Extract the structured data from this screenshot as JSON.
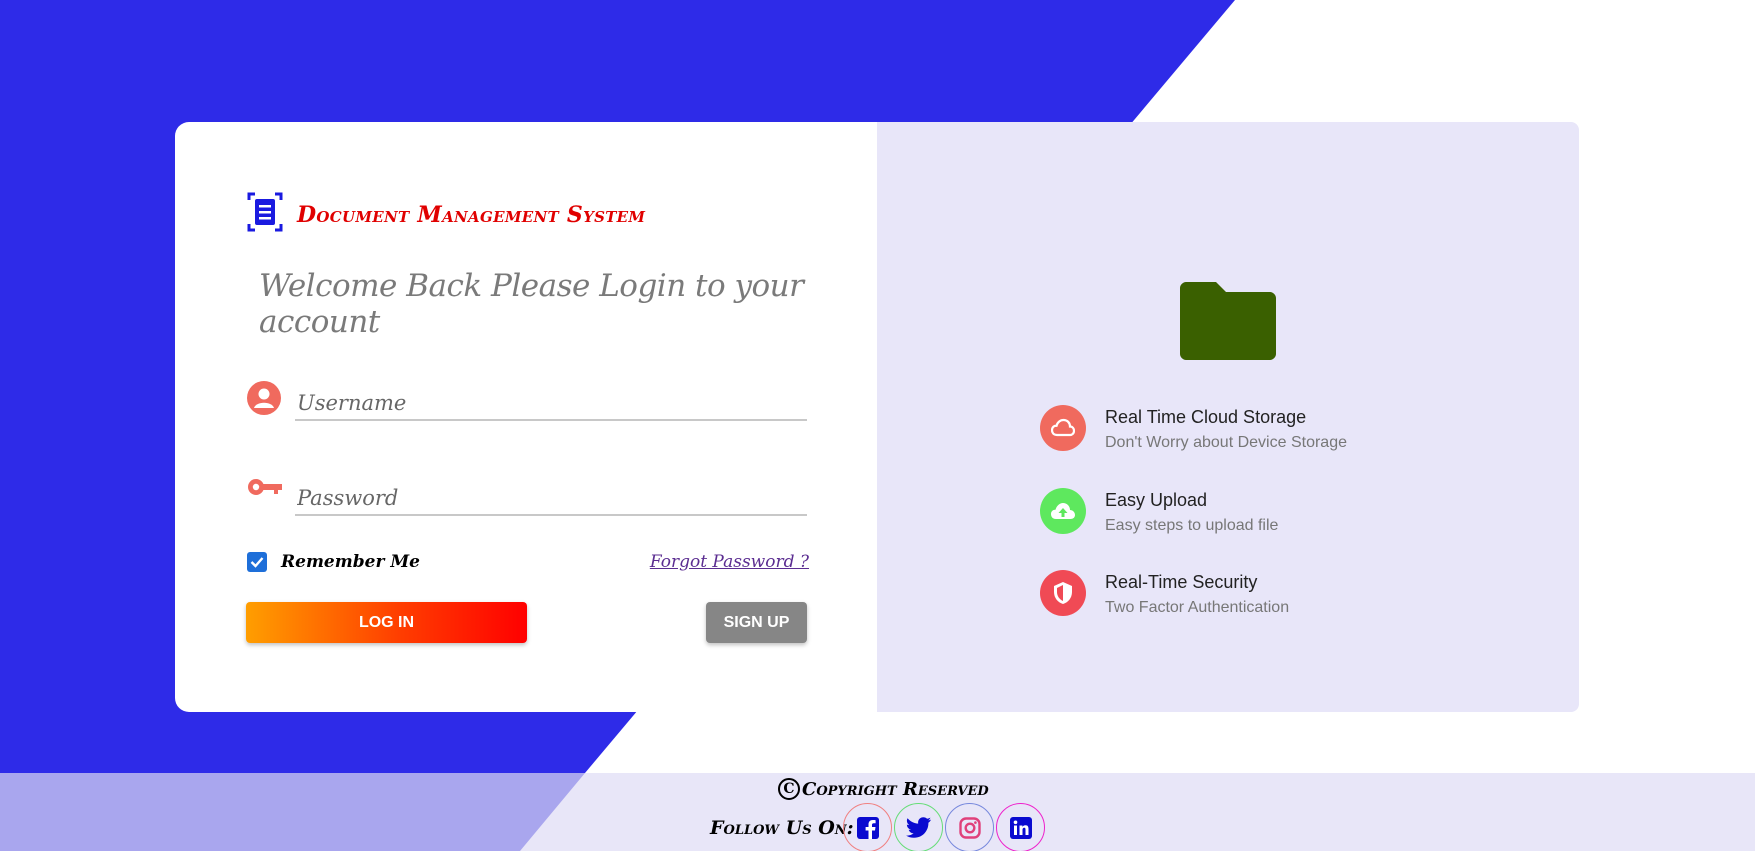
{
  "brand": {
    "title": "Document Management System",
    "icon": "document-scan-icon",
    "color": "#e00000"
  },
  "login": {
    "welcome": "Welcome Back Please Login to your account",
    "username_placeholder": "Username",
    "username_value": "",
    "password_placeholder": "Password",
    "password_value": "",
    "remember_label": "Remember Me",
    "remember_checked": true,
    "forgot_label": "Forgot Password ?",
    "login_label": "LOG IN",
    "signup_label": "SIGN UP"
  },
  "features": {
    "hero_icon": "folder-icon",
    "items": [
      {
        "title": "Real Time Cloud Storage",
        "subtitle": "Don't Worry about Device Storage",
        "icon": "cloud-icon",
        "color": "#f06a5e"
      },
      {
        "title": "Easy Upload",
        "subtitle": "Easy steps to upload file",
        "icon": "cloud-upload-icon",
        "color": "#5ee85e"
      },
      {
        "title": "Real-Time Security",
        "subtitle": "Two Factor Authentication",
        "icon": "shield-icon",
        "color": "#f04a55"
      }
    ]
  },
  "footer": {
    "copyright_symbol": "C",
    "copyright_text": "Copyright Reserved",
    "follow_label": "Follow Us On:",
    "socials": [
      "facebook-icon",
      "twitter-icon",
      "instagram-icon",
      "linkedin-icon"
    ]
  },
  "colors": {
    "background": "#2e2be8",
    "accent": "#f06a5e",
    "right_panel": "#e8e6f9",
    "footer": "#e8e6f8",
    "footer_left": "#a9a6ee"
  }
}
